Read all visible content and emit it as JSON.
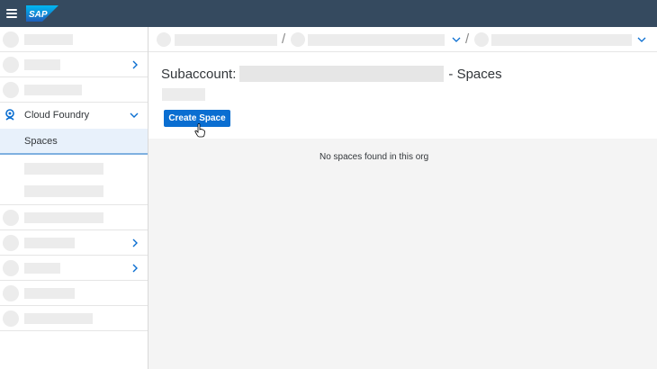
{
  "shell": {
    "logo_text": "SAP",
    "bg_color": "#354a5f",
    "menu_icon": "hamburger-icon"
  },
  "sidebar": {
    "items": [
      {
        "label": "",
        "has_chevron": false
      },
      {
        "label": "",
        "has_chevron": true
      },
      {
        "label": "",
        "has_chevron": false
      },
      {
        "label": "Cloud Foundry",
        "icon": "cloud-foundry-icon",
        "expanded": true
      },
      {
        "label": "Spaces",
        "selected": true
      },
      {
        "label": "",
        "has_chevron": false
      },
      {
        "label": "",
        "has_chevron": true
      },
      {
        "label": "",
        "has_chevron": true
      },
      {
        "label": "",
        "has_chevron": false
      },
      {
        "label": "",
        "has_chevron": false
      }
    ]
  },
  "breadcrumb": {
    "separator": "/"
  },
  "main": {
    "title_prefix": "Subaccount:",
    "title_suffix": "- Spaces",
    "create_button": "Create Space",
    "empty_message": "No spaces found in this org",
    "accent_color": "#0a6ed1"
  }
}
